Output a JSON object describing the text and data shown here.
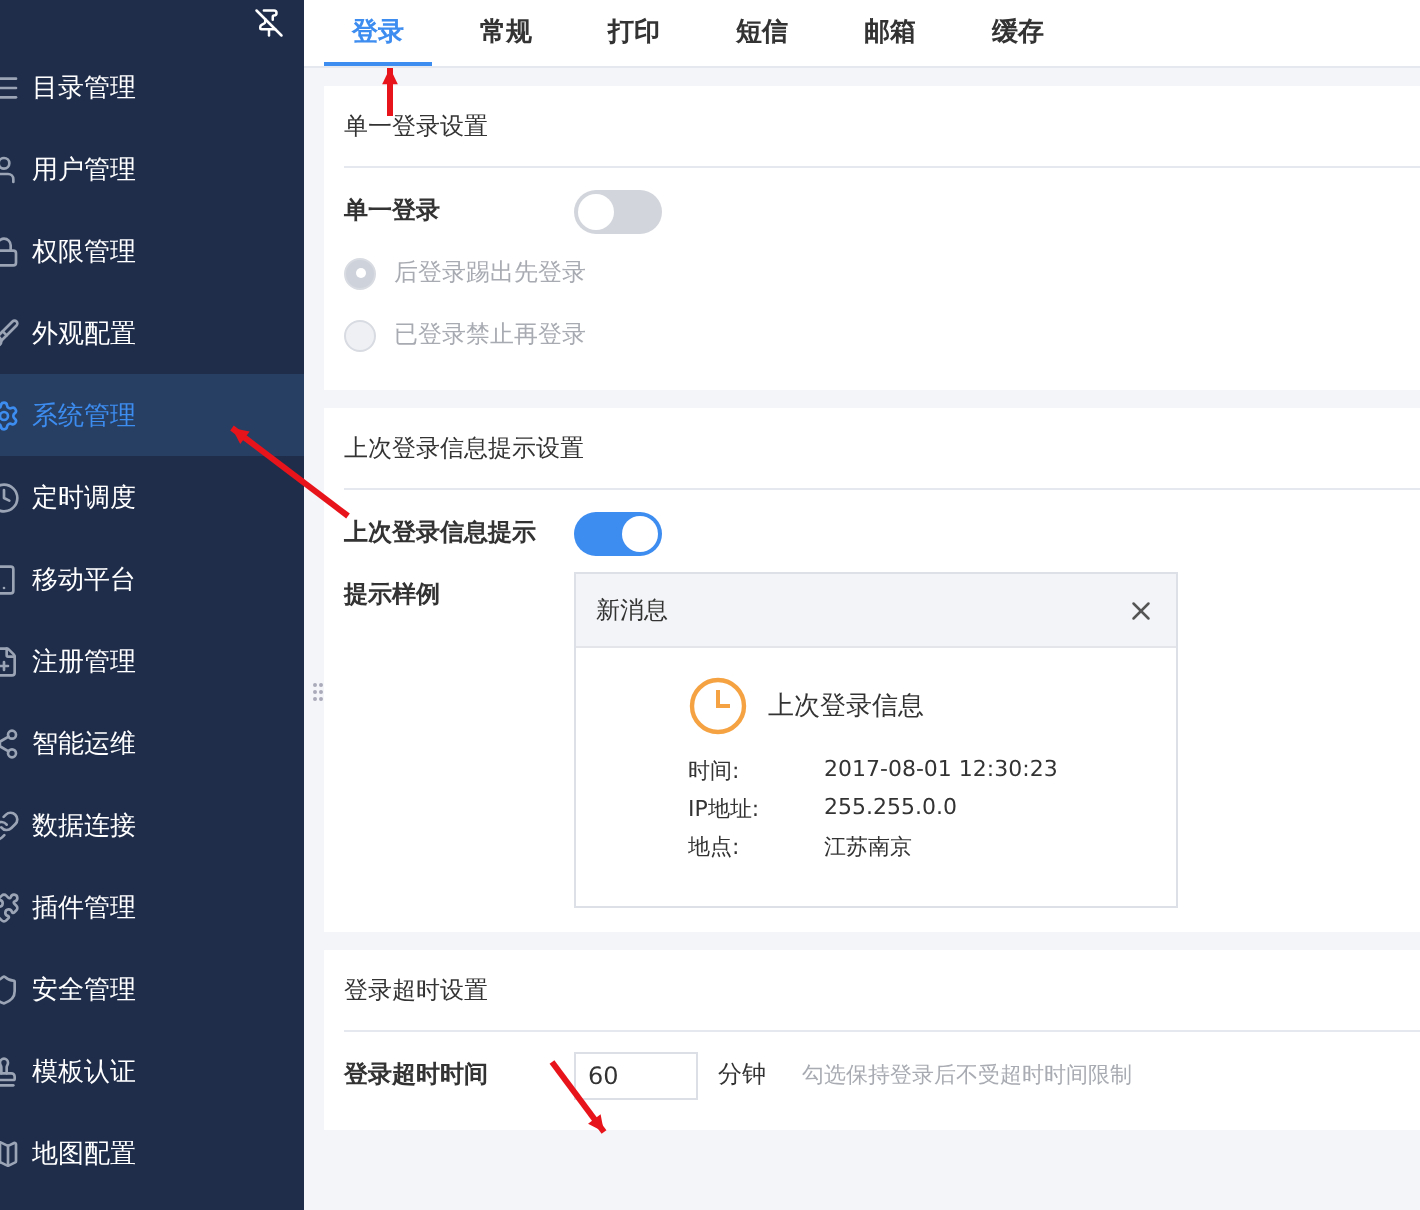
{
  "sidebar": {
    "items": [
      {
        "label": "目录管理",
        "selected": false
      },
      {
        "label": "用户管理",
        "selected": false
      },
      {
        "label": "权限管理",
        "selected": false
      },
      {
        "label": "外观配置",
        "selected": false
      },
      {
        "label": "系统管理",
        "selected": true
      },
      {
        "label": "定时调度",
        "selected": false
      },
      {
        "label": "移动平台",
        "selected": false
      },
      {
        "label": "注册管理",
        "selected": false
      },
      {
        "label": "智能运维",
        "selected": false
      },
      {
        "label": "数据连接",
        "selected": false
      },
      {
        "label": "插件管理",
        "selected": false
      },
      {
        "label": "安全管理",
        "selected": false
      },
      {
        "label": "模板认证",
        "selected": false
      },
      {
        "label": "地图配置",
        "selected": false
      }
    ]
  },
  "tabs": [
    {
      "label": "登录",
      "selected": true
    },
    {
      "label": "常规",
      "selected": false
    },
    {
      "label": "打印",
      "selected": false
    },
    {
      "label": "短信",
      "selected": false
    },
    {
      "label": "邮箱",
      "selected": false
    },
    {
      "label": "缓存",
      "selected": false
    }
  ],
  "single_login": {
    "title": "单一登录设置",
    "label": "单一登录",
    "on": false,
    "options": [
      {
        "label": "后登录踢出先登录",
        "selected": true,
        "disabled": true
      },
      {
        "label": "已登录禁止再登录",
        "selected": false,
        "disabled": true
      }
    ]
  },
  "last_login": {
    "title": "上次登录信息提示设置",
    "label": "上次登录信息提示",
    "on": true,
    "sample_label": "提示样例",
    "sample": {
      "title": "新消息",
      "heading": "上次登录信息",
      "rows": [
        {
          "key": "时间:",
          "value": "2017-08-01 12:30:23"
        },
        {
          "key": "IP地址:",
          "value": "255.255.0.0"
        },
        {
          "key": "地点:",
          "value": "江苏南京"
        }
      ]
    }
  },
  "timeout": {
    "title": "登录超时设置",
    "label": "登录超时时间",
    "value": "60",
    "unit": "分钟",
    "hint": "勾选保持登录后不受超时时间限制"
  }
}
